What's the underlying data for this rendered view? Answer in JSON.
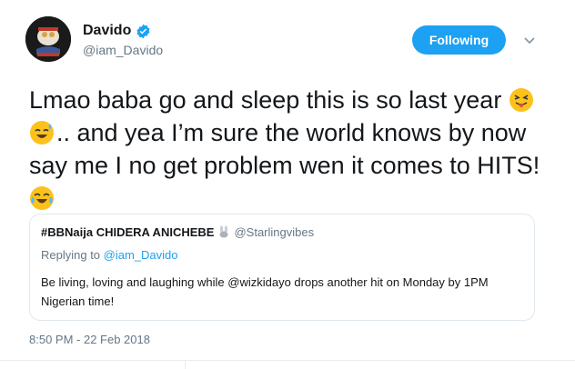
{
  "author": {
    "name": "Davido",
    "handle": "@iam_Davido",
    "verified": true
  },
  "follow_button": {
    "label": "Following"
  },
  "tweet": {
    "text_part1": "Lmao baba go and sleep this is so last year ",
    "text_part2": ".. and yea I’m sure the world knows by now say me I no get problem wen it comes to HITS! ",
    "emojis": [
      "squinting-tongue-emoji",
      "sweat-smile-emoji",
      "tears-of-joy-emoji"
    ]
  },
  "quoted_tweet": {
    "name": "#BBNaija CHIDERA ANICHEBE",
    "handle": "@Starlingvibes",
    "replying_prefix": "Replying to ",
    "replying_to": "@iam_Davido",
    "body": "Be living, loving and laughing while @wizkidayo drops another hit on Monday by 1PM Nigerian time!"
  },
  "timestamp": "8:50 PM - 22 Feb 2018",
  "colors": {
    "accent": "#1da1f2",
    "muted": "#657786",
    "text": "#14171a"
  }
}
